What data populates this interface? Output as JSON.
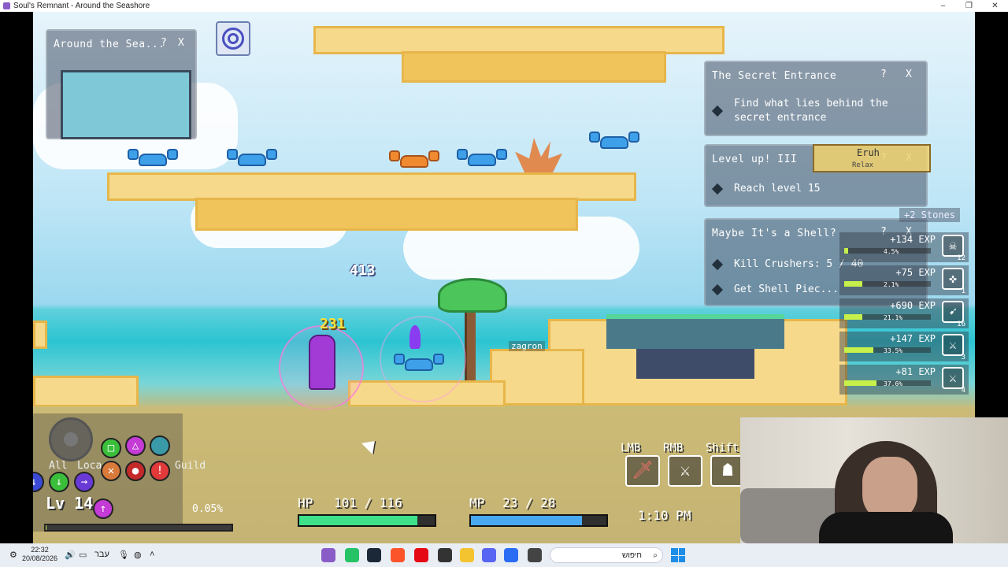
{
  "window": {
    "title": "Soul's Remnant - Around the Seashore",
    "controls": [
      "–",
      "❐",
      "✕"
    ]
  },
  "minimap_panel": {
    "title": "Around the Sea...",
    "help": "?",
    "close": "X"
  },
  "quests": [
    {
      "title": "The Secret Entrance",
      "help": "?",
      "close": "X",
      "objectives": [
        "Find what lies behind the secret entrance"
      ]
    },
    {
      "title": "Level up! III",
      "help": "?",
      "close": "X",
      "objectives": [
        "Reach level 15"
      ]
    },
    {
      "title": "Maybe It's a Shell?",
      "help": "?",
      "close": "X",
      "objectives": [
        "Kill Crushers: 5 / 40",
        "Get Shell Piec..."
      ]
    }
  ],
  "party_tag": {
    "name": "Eruh",
    "sub": "Relax"
  },
  "stones_notice": "+2 Stones",
  "exp_feed": [
    {
      "text": "+134 EXP",
      "pct": "4.5%",
      "fill": 0.045,
      "level": "12",
      "icon": "skull-icon"
    },
    {
      "text": "+75 EXP",
      "pct": "2.1%",
      "fill": 0.21,
      "level": "1",
      "icon": "crosshair-icon"
    },
    {
      "text": "+690 EXP",
      "pct": "21.1%",
      "fill": 0.211,
      "level": "16",
      "icon": "bow-icon"
    },
    {
      "text": "+147 EXP",
      "pct": "33.5%",
      "fill": 0.335,
      "level": "3",
      "icon": "crossed-swords-icon"
    },
    {
      "text": "+81 EXP",
      "pct": "37.6%",
      "fill": 0.376,
      "level": "4",
      "icon": "crossed-swords-icon"
    }
  ],
  "world": {
    "damage_numbers": [
      "413",
      "231"
    ],
    "other_player": "zagron"
  },
  "chat": {
    "tabs": [
      "All",
      "Loca",
      "Guild"
    ]
  },
  "player": {
    "level_label": "Lv 14",
    "exp_percent": "0.05%",
    "exp_fill": 0.0005,
    "hp_label": "HP",
    "hp_text": "101 / 116",
    "hp_fill": 0.87,
    "mp_label": "MP",
    "mp_text": "23 / 28",
    "mp_fill": 0.82
  },
  "skills": [
    {
      "key": "LMB",
      "icon": "sword-icon"
    },
    {
      "key": "RMB",
      "icon": "dash-sword-icon"
    },
    {
      "key": "Shift",
      "icon": "shadow-icon"
    }
  ],
  "game_clock": "1:10 PM",
  "taskbar": {
    "time": "22:32",
    "date": "20/08/2026",
    "language": "עבר",
    "search_placeholder": "חיפוש"
  },
  "colors": {
    "hp": "#3ee08a",
    "mp": "#4aa8f0",
    "exp": "#c7f04a",
    "sand": "#f6d98a"
  }
}
